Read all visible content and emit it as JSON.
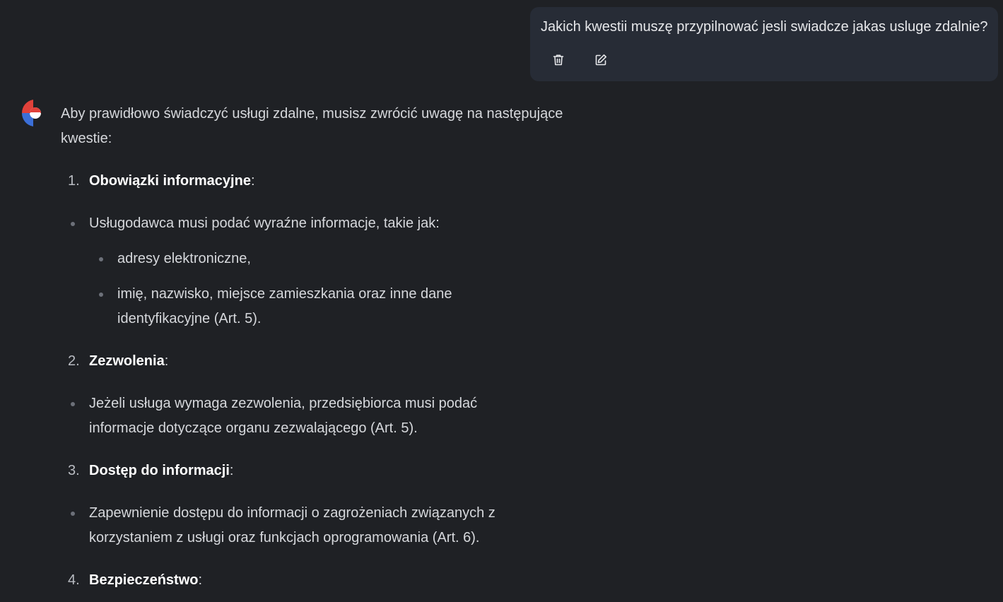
{
  "user_message": {
    "text": "Jakich kwestii muszę przypilnować jesli swiadcze jakas usluge zdalnie?",
    "actions": [
      {
        "icon": "trash-icon"
      },
      {
        "icon": "edit-icon"
      }
    ]
  },
  "assistant": {
    "avatar_icon": "assistant-logo",
    "intro": "Aby prawidłowo świadczyć usługi zdalne, musisz zwrócić uwagę na następujące kwestie:",
    "sections": [
      {
        "number": "1.",
        "title": "Obowiązki informacyjne",
        "suffix": ":",
        "bullet": "Usługodawca musi podać wyraźne informacje, takie jak:",
        "subbullets": [
          "adresy elektroniczne,",
          "imię, nazwisko, miejsce zamieszkania oraz inne dane identyfikacyjne (Art. 5)."
        ]
      },
      {
        "number": "2.",
        "title": "Zezwolenia",
        "suffix": ":",
        "bullet": "Jeżeli usługa wymaga zezwolenia, przedsiębiorca musi podać informacje dotyczące organu zezwalającego (Art. 5)."
      },
      {
        "number": "3.",
        "title": "Dostęp do informacji",
        "suffix": ":",
        "bullet": "Zapewnienie dostępu do informacji o zagrożeniach związanych z korzystaniem z usługi oraz funkcjach oprogramowania (Art. 6)."
      },
      {
        "number": "4.",
        "title": "Bezpieczeństwo",
        "suffix": ":"
      }
    ]
  },
  "colors": {
    "background": "#1f2125",
    "user_bubble": "#272c36",
    "text": "#d6d8dc",
    "heading": "#ffffff",
    "logo_red": "#e0413a",
    "logo_blue": "#3b6fd8"
  }
}
